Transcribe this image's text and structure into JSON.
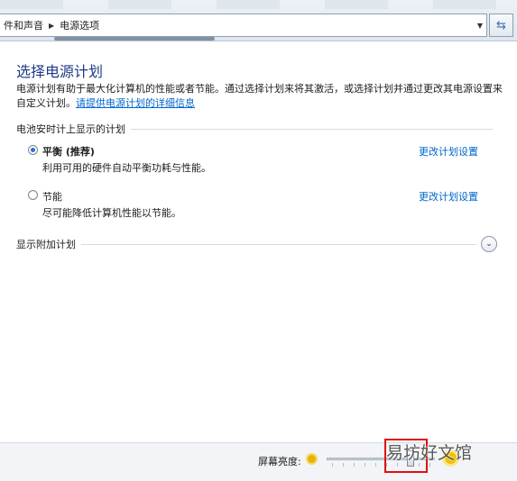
{
  "breadcrumb": {
    "parent": "件和声音",
    "separator": "▶",
    "current": "电源选项"
  },
  "page": {
    "title": "选择电源计划",
    "description": "电源计划有助于最大化计算机的性能或者节能。通过选择计划来将其激活，或选择计划并通过更改其电源设置来自定义计划。",
    "info_link": "请提供电源计划的详细信息"
  },
  "battery_section": {
    "label": "电池安时计上显示的计划",
    "plans": [
      {
        "name": "平衡 (推荐)",
        "description": "利用可用的硬件自动平衡功耗与性能。",
        "selected": true,
        "change_link": "更改计划设置"
      },
      {
        "name": "节能",
        "description": "尽可能降低计算机性能以节能。",
        "selected": false,
        "change_link": "更改计划设置"
      }
    ]
  },
  "additional_section": {
    "label": "显示附加计划"
  },
  "bottom": {
    "brightness_label": "屏幕亮度:"
  },
  "watermark": "易坊好文馆",
  "colors": {
    "title": "#1e3a87",
    "link": "#0066cc",
    "highlight": "#e01010"
  },
  "icons": {
    "refresh": "refresh-icon",
    "dropdown": "chevron-down-icon",
    "expand": "expand-circle-icon",
    "brightness_low": "sun-small-icon",
    "brightness_high": "sun-large-icon"
  }
}
